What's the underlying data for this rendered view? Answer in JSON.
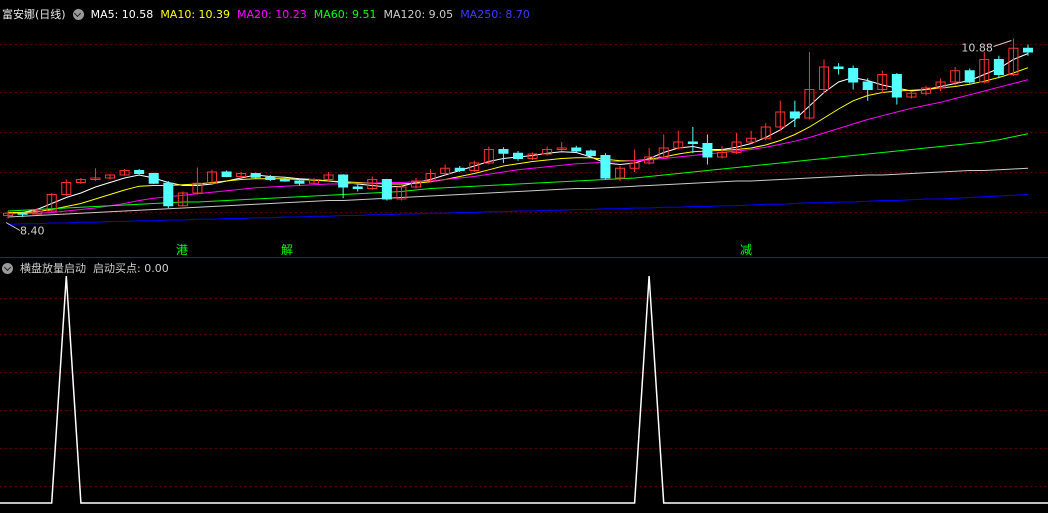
{
  "header": {
    "symbol": "富安娜(日线)",
    "ma": [
      {
        "label": "MA5: 10.58",
        "color": "#ffffff"
      },
      {
        "label": "MA10: 10.39",
        "color": "#ffff00"
      },
      {
        "label": "MA20: 10.23",
        "color": "#ff00ff"
      },
      {
        "label": "MA60: 9.51",
        "color": "#00ff00"
      },
      {
        "label": "MA120: 9.05",
        "color": "#cccccc"
      },
      {
        "label": "MA250: 8.70",
        "color": "#0000ff"
      }
    ]
  },
  "indicator": {
    "name": "横盘放量启动",
    "value_label": "启动买点: 0.00"
  },
  "markers": [
    {
      "text": "港",
      "color": "#00ff00",
      "index": 11
    },
    {
      "text": "解",
      "color": "#00ff00",
      "index": 18
    },
    {
      "text": "减",
      "color": "#00ff00",
      "index": 48
    }
  ],
  "chart_data": [
    {
      "type": "candlestick",
      "high_label": "10.88",
      "low_label": "8.40",
      "ylim": [
        8.2,
        11.0
      ],
      "colors": {
        "up": "#ff3232",
        "down": "#54ffff"
      },
      "candles": [
        [
          8.42,
          8.45,
          8.38,
          8.48
        ],
        [
          8.45,
          8.44,
          8.4,
          8.47
        ],
        [
          8.44,
          8.48,
          8.43,
          8.52
        ],
        [
          8.48,
          8.7,
          8.46,
          8.72
        ],
        [
          8.7,
          8.86,
          8.68,
          8.9
        ],
        [
          8.86,
          8.9,
          8.84,
          8.92
        ],
        [
          8.9,
          8.92,
          8.88,
          9.05
        ],
        [
          8.92,
          8.96,
          8.9,
          8.97
        ],
        [
          8.96,
          9.02,
          8.95,
          9.04
        ],
        [
          9.02,
          8.98,
          8.97,
          9.04
        ],
        [
          8.98,
          8.85,
          8.84,
          8.99
        ],
        [
          8.85,
          8.55,
          8.52,
          8.88
        ],
        [
          8.55,
          8.72,
          8.54,
          8.74
        ],
        [
          8.72,
          8.85,
          8.7,
          9.06
        ],
        [
          8.85,
          9.0,
          8.84,
          9.03
        ],
        [
          9.0,
          8.94,
          8.93,
          9.02
        ],
        [
          8.94,
          8.98,
          8.92,
          9.0
        ],
        [
          8.98,
          8.93,
          8.91,
          8.99
        ],
        [
          8.93,
          8.9,
          8.88,
          8.96
        ],
        [
          8.9,
          8.88,
          8.87,
          8.92
        ],
        [
          8.88,
          8.85,
          8.82,
          8.9
        ],
        [
          8.85,
          8.9,
          8.84,
          8.92
        ],
        [
          8.9,
          8.96,
          8.88,
          9.0
        ],
        [
          8.96,
          8.8,
          8.65,
          8.97
        ],
        [
          8.8,
          8.78,
          8.74,
          8.83
        ],
        [
          8.78,
          8.9,
          8.76,
          8.94
        ],
        [
          8.9,
          8.64,
          8.62,
          8.91
        ],
        [
          8.64,
          8.8,
          8.62,
          8.84
        ],
        [
          8.8,
          8.88,
          8.78,
          8.92
        ],
        [
          8.88,
          8.98,
          8.86,
          9.04
        ],
        [
          8.98,
          9.05,
          8.96,
          9.1
        ],
        [
          9.05,
          9.02,
          9.0,
          9.08
        ],
        [
          9.02,
          9.12,
          9.0,
          9.15
        ],
        [
          9.12,
          9.3,
          9.1,
          9.34
        ],
        [
          9.3,
          9.25,
          9.12,
          9.33
        ],
        [
          9.25,
          9.18,
          9.15,
          9.28
        ],
        [
          9.18,
          9.24,
          9.16,
          9.26
        ],
        [
          9.24,
          9.3,
          9.22,
          9.34
        ],
        [
          9.3,
          9.32,
          9.28,
          9.4
        ],
        [
          9.32,
          9.28,
          9.26,
          9.35
        ],
        [
          9.28,
          9.22,
          9.2,
          9.3
        ],
        [
          9.22,
          8.92,
          8.9,
          9.25
        ],
        [
          8.92,
          9.05,
          8.88,
          9.08
        ],
        [
          9.05,
          9.12,
          9.0,
          9.3
        ],
        [
          9.12,
          9.2,
          9.1,
          9.32
        ],
        [
          9.2,
          9.32,
          9.18,
          9.5
        ],
        [
          9.32,
          9.4,
          9.3,
          9.55
        ],
        [
          9.4,
          9.38,
          9.25,
          9.6
        ],
        [
          9.38,
          9.2,
          9.1,
          9.5
        ],
        [
          9.2,
          9.26,
          9.18,
          9.35
        ],
        [
          9.26,
          9.4,
          9.24,
          9.52
        ],
        [
          9.4,
          9.45,
          9.38,
          9.55
        ],
        [
          9.45,
          9.6,
          9.42,
          9.65
        ],
        [
          9.6,
          9.8,
          9.55,
          9.95
        ],
        [
          9.8,
          9.72,
          9.6,
          9.95
        ],
        [
          9.72,
          10.1,
          9.7,
          10.6
        ],
        [
          10.1,
          10.4,
          10.05,
          10.5
        ],
        [
          10.4,
          10.38,
          10.3,
          10.45
        ],
        [
          10.38,
          10.2,
          10.1,
          10.42
        ],
        [
          10.2,
          10.1,
          9.95,
          10.25
        ],
        [
          10.1,
          10.3,
          10.05,
          10.35
        ],
        [
          10.3,
          10.0,
          9.9,
          10.32
        ],
        [
          10.0,
          10.05,
          9.98,
          10.08
        ],
        [
          10.05,
          10.12,
          10.02,
          10.15
        ],
        [
          10.12,
          10.2,
          10.08,
          10.25
        ],
        [
          10.2,
          10.35,
          10.15,
          10.4
        ],
        [
          10.35,
          10.2,
          10.18,
          10.38
        ],
        [
          10.2,
          10.5,
          10.18,
          10.6
        ],
        [
          10.5,
          10.3,
          10.25,
          10.55
        ],
        [
          10.3,
          10.65,
          10.28,
          10.78
        ],
        [
          10.65,
          10.6,
          10.55,
          10.7
        ]
      ],
      "ma": [
        {
          "name": "MA5",
          "color": "#ffffff",
          "values": [
            8.45,
            8.46,
            8.5,
            8.58,
            8.66,
            8.72,
            8.8,
            8.86,
            8.92,
            8.96,
            8.92,
            8.86,
            8.82,
            8.82,
            8.84,
            8.88,
            8.92,
            8.96,
            8.94,
            8.93,
            8.91,
            8.9,
            8.88,
            8.86,
            8.84,
            8.82,
            8.8,
            8.81,
            8.86,
            8.9,
            8.96,
            9.02,
            9.08,
            9.14,
            9.18,
            9.2,
            9.22,
            9.25,
            9.27,
            9.26,
            9.2,
            9.12,
            9.1,
            9.12,
            9.18,
            9.26,
            9.32,
            9.34,
            9.3,
            9.3,
            9.33,
            9.38,
            9.46,
            9.56,
            9.7,
            9.88,
            10.06,
            10.2,
            10.26,
            10.22,
            10.16,
            10.12,
            10.08,
            10.1,
            10.14,
            10.18,
            10.22,
            10.3,
            10.38,
            10.5,
            10.58
          ]
        },
        {
          "name": "MA10",
          "color": "#ffff00",
          "values": [
            8.46,
            8.46,
            8.47,
            8.5,
            8.54,
            8.58,
            8.64,
            8.7,
            8.76,
            8.81,
            8.82,
            8.82,
            8.83,
            8.84,
            8.86,
            8.88,
            8.9,
            8.91,
            8.91,
            8.91,
            8.9,
            8.89,
            8.88,
            8.87,
            8.86,
            8.85,
            8.84,
            8.84,
            8.85,
            8.87,
            8.9,
            8.94,
            8.98,
            9.03,
            9.08,
            9.11,
            9.14,
            9.16,
            9.18,
            9.19,
            9.19,
            9.17,
            9.15,
            9.15,
            9.17,
            9.2,
            9.24,
            9.27,
            9.28,
            9.29,
            9.3,
            9.32,
            9.36,
            9.42,
            9.5,
            9.6,
            9.72,
            9.84,
            9.95,
            10.02,
            10.06,
            10.08,
            10.09,
            10.1,
            10.12,
            10.14,
            10.17,
            10.21,
            10.26,
            10.32,
            10.39
          ]
        },
        {
          "name": "MA20",
          "color": "#ff00ff",
          "values": [
            8.44,
            8.45,
            8.45,
            8.46,
            8.48,
            8.5,
            8.52,
            8.55,
            8.58,
            8.62,
            8.65,
            8.67,
            8.69,
            8.71,
            8.73,
            8.75,
            8.77,
            8.79,
            8.8,
            8.81,
            8.82,
            8.83,
            8.84,
            8.84,
            8.85,
            8.85,
            8.86,
            8.86,
            8.87,
            8.88,
            8.9,
            8.92,
            8.94,
            8.97,
            9.0,
            9.03,
            9.05,
            9.07,
            9.09,
            9.11,
            9.12,
            9.13,
            9.14,
            9.15,
            9.16,
            9.18,
            9.2,
            9.22,
            9.24,
            9.26,
            9.28,
            9.3,
            9.33,
            9.37,
            9.41,
            9.46,
            9.52,
            9.58,
            9.64,
            9.7,
            9.75,
            9.8,
            9.85,
            9.89,
            9.93,
            9.98,
            10.03,
            10.08,
            10.13,
            10.18,
            10.23
          ]
        },
        {
          "name": "MA60",
          "color": "#00ff00",
          "values": [
            8.48,
            8.49,
            8.5,
            8.51,
            8.52,
            8.53,
            8.54,
            8.55,
            8.56,
            8.57,
            8.58,
            8.59,
            8.6,
            8.6,
            8.61,
            8.62,
            8.63,
            8.64,
            8.65,
            8.66,
            8.67,
            8.68,
            8.69,
            8.7,
            8.71,
            8.72,
            8.73,
            8.74,
            8.76,
            8.78,
            8.79,
            8.8,
            8.81,
            8.82,
            8.83,
            8.84,
            8.85,
            8.86,
            8.87,
            8.88,
            8.89,
            8.9,
            8.91,
            8.92,
            8.94,
            8.96,
            8.98,
            9.0,
            9.02,
            9.04,
            9.06,
            9.08,
            9.1,
            9.12,
            9.14,
            9.16,
            9.18,
            9.2,
            9.22,
            9.24,
            9.26,
            9.28,
            9.3,
            9.32,
            9.34,
            9.36,
            9.38,
            9.4,
            9.43,
            9.47,
            9.51
          ]
        },
        {
          "name": "MA120",
          "color": "#cccccc",
          "values": [
            8.4,
            8.41,
            8.42,
            8.43,
            8.44,
            8.45,
            8.46,
            8.47,
            8.48,
            8.49,
            8.5,
            8.51,
            8.52,
            8.53,
            8.54,
            8.55,
            8.56,
            8.57,
            8.58,
            8.59,
            8.6,
            8.61,
            8.62,
            8.62,
            8.63,
            8.64,
            8.65,
            8.66,
            8.67,
            8.68,
            8.69,
            8.7,
            8.71,
            8.72,
            8.73,
            8.74,
            8.75,
            8.76,
            8.77,
            8.78,
            8.78,
            8.79,
            8.8,
            8.81,
            8.82,
            8.83,
            8.84,
            8.85,
            8.86,
            8.87,
            8.88,
            8.88,
            8.89,
            8.9,
            8.91,
            8.92,
            8.93,
            8.94,
            8.95,
            8.96,
            8.96,
            8.97,
            8.98,
            8.99,
            9.0,
            9.01,
            9.02,
            9.02,
            9.03,
            9.04,
            9.05
          ]
        },
        {
          "name": "MA250",
          "color": "#0000ff",
          "values": [
            8.3,
            8.31,
            8.31,
            8.32,
            8.32,
            8.33,
            8.33,
            8.34,
            8.34,
            8.35,
            8.35,
            8.36,
            8.36,
            8.37,
            8.37,
            8.38,
            8.38,
            8.39,
            8.39,
            8.4,
            8.4,
            8.41,
            8.41,
            8.42,
            8.42,
            8.43,
            8.43,
            8.44,
            8.44,
            8.45,
            8.45,
            8.46,
            8.46,
            8.47,
            8.47,
            8.48,
            8.48,
            8.49,
            8.49,
            8.5,
            8.5,
            8.51,
            8.51,
            8.52,
            8.52,
            8.53,
            8.53,
            8.54,
            8.54,
            8.55,
            8.55,
            8.56,
            8.57,
            8.57,
            8.58,
            8.59,
            8.59,
            8.6,
            8.6,
            8.61,
            8.62,
            8.62,
            8.63,
            8.64,
            8.64,
            8.65,
            8.66,
            8.67,
            8.68,
            8.69,
            8.7
          ]
        }
      ]
    },
    {
      "type": "line",
      "title": "启动买点",
      "color": "#ffffff",
      "ylim": [
        0,
        1
      ],
      "values": [
        0,
        0,
        0,
        0,
        1,
        0,
        0,
        0,
        0,
        0,
        0,
        0,
        0,
        0,
        0,
        0,
        0,
        0,
        0,
        0,
        0,
        0,
        0,
        0,
        0,
        0,
        0,
        0,
        0,
        0,
        0,
        0,
        0,
        0,
        0,
        0,
        0,
        0,
        0,
        0,
        0,
        0,
        0,
        0,
        1,
        0,
        0,
        0,
        0,
        0,
        0,
        0,
        0,
        0,
        0,
        0,
        0,
        0,
        0,
        0,
        0,
        0,
        0,
        0,
        0,
        0,
        0,
        0,
        0,
        0,
        0
      ]
    }
  ]
}
